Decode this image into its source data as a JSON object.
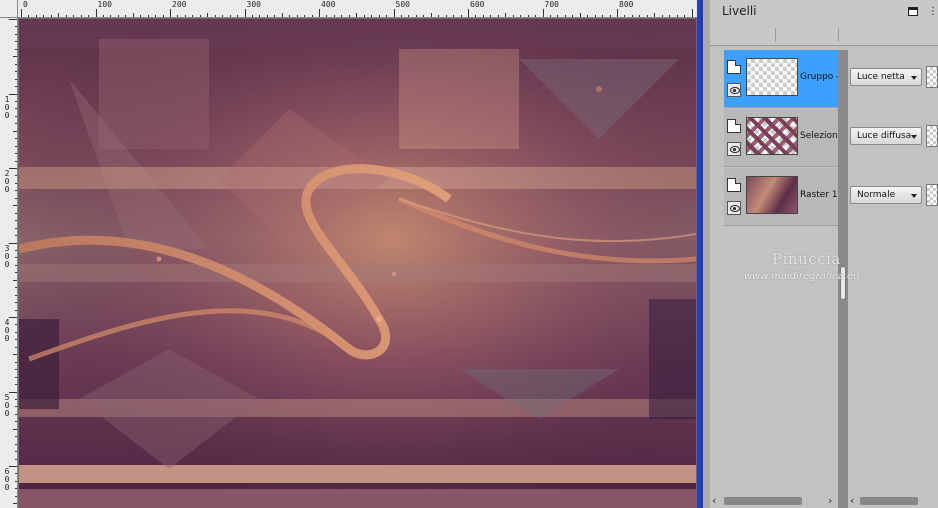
{
  "ruler": {
    "top_labels": [
      "0",
      "100",
      "200",
      "300",
      "400",
      "500",
      "600",
      "700",
      "800"
    ],
    "left_labels": [
      "1\n0\n0",
      "2\n0\n0",
      "3\n0\n0",
      "4\n0\n0",
      "5\n0\n0",
      "6\n0\n0"
    ]
  },
  "panel": {
    "title": "Livelli",
    "layers": [
      {
        "name": "Gruppo -",
        "blend_mode": "Luce netta",
        "selected": true,
        "thumb": "transparent"
      },
      {
        "name": "Selezione",
        "blend_mode": "Luce diffusa",
        "selected": false,
        "thumb": "selection"
      },
      {
        "name": "Raster 1",
        "blend_mode": "Normale",
        "selected": false,
        "thumb": "raster"
      }
    ]
  },
  "watermark": {
    "name": "Pinuccia",
    "url": "www.maidiregrafica.eu"
  },
  "colors": {
    "selected_row": "#3da0ff",
    "window_border": "#1f3bb5"
  }
}
